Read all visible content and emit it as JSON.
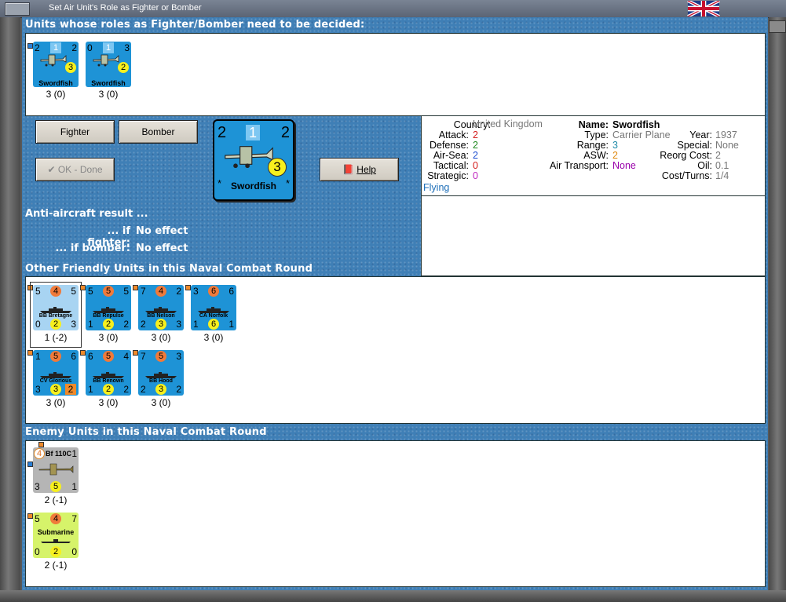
{
  "window": {
    "title": "Set Air Unit's Role as Fighter or Bomber"
  },
  "headers": {
    "undecided": "Units whose roles as Fighter/Bomber need to be decided:",
    "friendly": "Other Friendly Units in this Naval Combat Round",
    "enemy": "Enemy Units in this Naval Combat Round"
  },
  "undecided_units": [
    {
      "name": "Swordfish",
      "tl": "2",
      "top": "1",
      "tr": "2",
      "circle": "3",
      "sub": "3 (0)"
    },
    {
      "name": "Swordfish",
      "tl": "0",
      "top": "1",
      "tr": "3",
      "circle": "2",
      "sub": "3 (0)"
    }
  ],
  "buttons": {
    "fighter": "Fighter",
    "bomber": "Bomber",
    "ok": "OK - Done",
    "help": "Help"
  },
  "big_unit": {
    "name": "Swordfish",
    "tl": "2",
    "top": "1",
    "tr": "2",
    "circle": "3",
    "star_l": "*",
    "star_r": "*"
  },
  "aa": {
    "title": "Anti-aircraft result ...",
    "fighter_label": "... if fighter:",
    "fighter_value": "No effect",
    "bomber_label": "... if bomber:",
    "bomber_value": "No effect"
  },
  "info": {
    "country_label": "Country:",
    "country": "United Kingdom",
    "attack_label": "Attack:",
    "attack": "2",
    "defense_label": "Defense:",
    "defense": "2",
    "airsea_label": "Air-Sea:",
    "airsea": "2",
    "tactical_label": "Tactical:",
    "tactical": "0",
    "strategic_label": "Strategic:",
    "strategic": "0",
    "status": "Flying",
    "name_label": "Name:",
    "name": "Swordfish",
    "type_label": "Type:",
    "type": "Carrier Plane",
    "range_label": "Range:",
    "range": "3",
    "asw_label": "ASW:",
    "asw": "2",
    "transport_label": "Air Transport:",
    "transport": "None",
    "year_label": "Year:",
    "year": "1937",
    "special_label": "Special:",
    "special": "None",
    "reorg_label": "Reorg Cost:",
    "reorg": "2",
    "oil_label": "Oil:",
    "oil": "0.1",
    "cost_label": "Cost/Turns:",
    "cost": "1/4"
  },
  "friendly_units": [
    {
      "name": "BB Bretagne",
      "tl": "5",
      "circle_top": "4",
      "tr": "5",
      "bl": "0",
      "circle_bot": "2",
      "br": "3",
      "sub": "1 (-2)",
      "selected": true
    },
    {
      "name": "BB Repulse",
      "tl": "5",
      "circle_top": "5",
      "tr": "5",
      "bl": "1",
      "circle_bot": "2",
      "br": "2",
      "sub": "3 (0)"
    },
    {
      "name": "BB Nelson",
      "tl": "7",
      "circle_top": "4",
      "tr": "2",
      "bl": "2",
      "circle_bot": "3",
      "br": "3",
      "sub": "3 (0)"
    },
    {
      "name": "CA Norfolk",
      "tl": "3",
      "circle_top": "6",
      "tr": "6",
      "bl": "1",
      "circle_bot": "6",
      "br": "1",
      "sub": "3 (0)"
    },
    {
      "name": "CV Glorious",
      "tl": "1",
      "circle_top": "5",
      "tr": "6",
      "bl": "3",
      "circle_bot": "3",
      "br": "2",
      "sub": "3 (0)"
    },
    {
      "name": "BB Renown",
      "tl": "6",
      "circle_top": "5",
      "tr": "4",
      "bl": "1",
      "circle_bot": "2",
      "br": "2",
      "sub": "3 (0)"
    },
    {
      "name": "BB Hood",
      "tl": "7",
      "circle_top": "5",
      "tr": "3",
      "bl": "2",
      "circle_bot": "3",
      "br": "2",
      "sub": "3 (0)"
    }
  ],
  "enemy_units": [
    {
      "name": "Bf 110C",
      "tl": "4",
      "tr": "1",
      "bl": "3",
      "circle": "5",
      "br": "1",
      "sub": "2 (-1)"
    },
    {
      "name": "Submarine",
      "tl": "5",
      "circle_top": "4",
      "tr": "7",
      "bl": "0",
      "circle_bot": "2",
      "br": "0",
      "sub": "2 (-1)"
    }
  ],
  "colors": {
    "naval_counter": "#1e93d6",
    "selected_counter": "#a8d4f2",
    "enemy_air": "#b5b5b5",
    "enemy_sub": "#d6f36a",
    "purple_value": "#9900aa"
  }
}
